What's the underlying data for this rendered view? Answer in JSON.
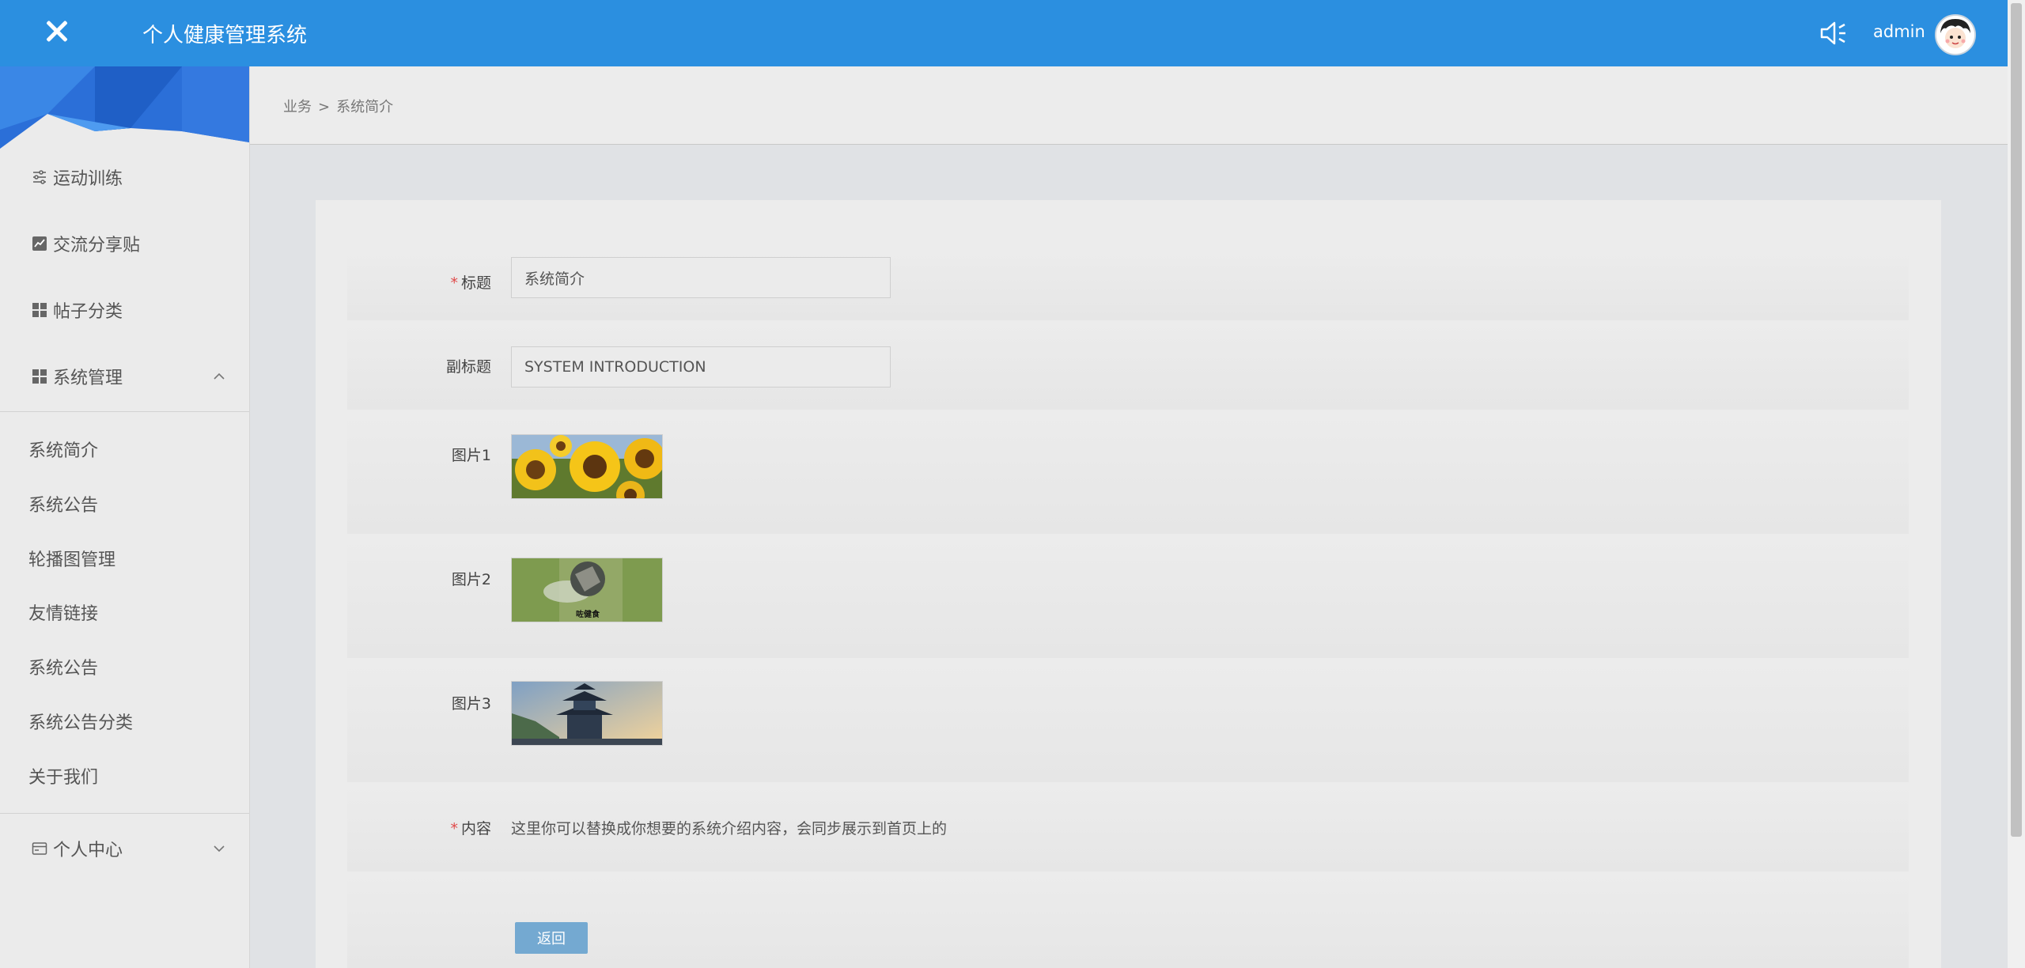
{
  "header": {
    "app_title": "个人健康管理系统",
    "username": "admin",
    "icons": [
      "close-icon",
      "speaker-icon",
      "avatar"
    ],
    "bg_color": "#2b8fe0"
  },
  "sidebar": {
    "items": [
      {
        "label": "运动训练",
        "icon": "sliders-icon"
      },
      {
        "label": "交流分享贴",
        "icon": "chart-icon"
      },
      {
        "label": "帖子分类",
        "icon": "grid-icon"
      },
      {
        "label": "系统管理",
        "icon": "grid-icon",
        "expanded": true
      }
    ],
    "sub_items": [
      "系统简介",
      "系统公告",
      "轮播图管理",
      "友情链接",
      "系统公告",
      "系统公告分类",
      "关于我们"
    ],
    "bottom_item": {
      "label": "个人中心",
      "icon": "card-icon",
      "expanded": false
    }
  },
  "breadcrumb": {
    "parent": "业务",
    "separator": ">",
    "current": "系统简介"
  },
  "form": {
    "title_label": "标题",
    "title_value": "系统简介",
    "subtitle_label": "副标题",
    "subtitle_value": "SYSTEM INTRODUCTION",
    "image1_label": "图片1",
    "image2_label": "图片2",
    "image3_label": "图片3",
    "image2_caption": "咗健食",
    "content_label": "内容",
    "content_value": "这里你可以替换成你想要的系统介绍内容，会同步展示到首页上的",
    "required_mark": "*",
    "back_button": "返回",
    "accent_color": "#74a9d1"
  }
}
